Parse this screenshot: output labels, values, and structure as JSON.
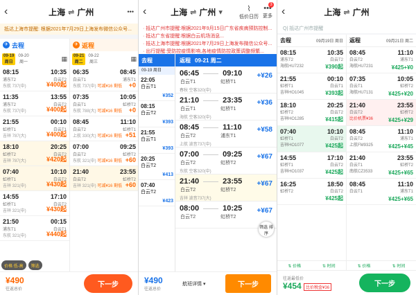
{
  "app1": {
    "back": "‹",
    "from": "上海",
    "to": "广州",
    "swap": "⇌",
    "more": "•••",
    "notice": "抵达上海市提醒: 根据2021年7月29日上海发布微信公众号...",
    "go_title": "去程",
    "ret_title": "返程",
    "go_dates": [
      {
        "d": "09-19",
        "w": "周日",
        "sel": true
      },
      {
        "d": "09-20",
        "w": "周一",
        "sel": false
      }
    ],
    "ret_dates": [
      {
        "d": "09-21",
        "w": "周二",
        "sel": true
      },
      {
        "d": "09-22",
        "w": "周三",
        "sel": false
      }
    ],
    "go_flights": [
      {
        "dep": "08:15",
        "arr": "10:35",
        "from": "浦东T2",
        "to": "白云T2",
        "info": "东航 737(中)",
        "price": "¥400起"
      },
      {
        "dep": "11:35",
        "arr": "13:55",
        "from": "浦东T2",
        "to": "白云T2",
        "info": "东航 737(中)",
        "price": "¥400起"
      },
      {
        "dep": "21:55",
        "arr": "00:10",
        "from": "虹桥T1",
        "to": "白云T1",
        "info": "吉祥 787(大)",
        "price": "¥400起"
      },
      {
        "dep": "18:10",
        "arr": "20:25",
        "from": "虹桥T2",
        "to": "白云T2",
        "info": "吉祥 787(大)",
        "price": "¥420起"
      },
      {
        "dep": "07:40",
        "arr": "10:10",
        "from": "虹桥T1",
        "to": "白云T2",
        "info": "吉祥 321(中)",
        "price": "¥430起"
      },
      {
        "dep": "14:55",
        "arr": "17:10",
        "from": "虹桥T1",
        "to": "白云T2",
        "info": "吉祥 321(中)",
        "price": "¥430起"
      },
      {
        "dep": "21:50",
        "arr": "00:15",
        "from": "浦东T1",
        "to": "白云T1",
        "info": "东航 321(中)",
        "price": "¥440起"
      }
    ],
    "ret_flights": [
      {
        "dep": "06:35",
        "arr": "08:45",
        "from": "白云T1",
        "to": "浦东T1",
        "info": "东航 737(中)",
        "tag": "可减¥16",
        "tag2": "剩低",
        "price": "+0"
      },
      {
        "dep": "07:35",
        "arr": "10:05",
        "from": "白云T1",
        "to": "虹桥T2",
        "info": "东航 788(大)",
        "tag": "可减¥16",
        "tag2": "剩低",
        "price": "+0"
      },
      {
        "dep": "08:45",
        "arr": "11:10",
        "from": "白云T2",
        "to": "虹桥T1",
        "info": "上航 330(大)",
        "tag": "可减¥16",
        "tag2": "剩低",
        "price": "+51"
      },
      {
        "dep": "07:00",
        "arr": "09:25",
        "from": "白云T2",
        "to": "虹桥T2",
        "info": "东航 321(中)",
        "tag": "可减¥16",
        "tag2": "剩低",
        "price": "+60"
      },
      {
        "dep": "21:40",
        "arr": "23:55",
        "from": "白云T2",
        "to": "虹桥T2",
        "info": "吉祥 321(中)",
        "tag": "可减¥16",
        "tag2": "剩低",
        "price": "+60"
      }
    ],
    "filter1": "价格 低-高",
    "filter2": "筛选",
    "total": "¥490",
    "total_label": "往返总价",
    "next": "下一步"
  },
  "app2": {
    "back": "‹",
    "from": "上海",
    "to": "广州",
    "icon1": "低价日历",
    "icon2": "更多",
    "badge": "3",
    "notices": [
      "· 抵达广州市提醒:根据2021年9月15日广东省疾病预防控制...",
      "· 抵达广东省提醒:根据白云机场消息...",
      "· 抵达上海市提醒:根据2021年7月29日上海发布微信公众号...",
      "· 出行提醒:受防控疫情影响,各地疫情防控政策调整频繁..."
    ],
    "left_head": "去程",
    "left_date": "09-19 周日",
    "left_flights": [
      {
        "dep": "22:05",
        "to": "白云T1",
        "price": "¥352"
      },
      {
        "dep": "08:15",
        "to": "白云T2",
        "price": "¥393"
      },
      {
        "dep": "21:55",
        "to": "白云T1",
        "price": "¥393"
      },
      {
        "dep": "20:25",
        "to": "白云T2",
        "price": "¥413"
      },
      {
        "dep": "07:40",
        "to": "白云T2",
        "price": "¥423"
      }
    ],
    "right_head": "返程",
    "right_date": "09-21 周二",
    "right_flights": [
      {
        "dep": "06:45",
        "arr": "09:10",
        "from": "白云T1",
        "to": "虹桥T1",
        "info": "春秋 空客320(中)",
        "price": "+¥26",
        "hl": false
      },
      {
        "dep": "21:10",
        "arr": "23:35",
        "from": "白云T1",
        "to": "虹桥T1",
        "info": "海航 空客320(中)",
        "price": "+¥36",
        "hl": false
      },
      {
        "dep": "08:45",
        "arr": "11:10",
        "from": "白云T2",
        "to": "浦东T1",
        "info": "上航 波音737(中)",
        "price": "+¥58",
        "hl": false
      },
      {
        "dep": "07:00",
        "arr": "09:25",
        "from": "白云T2",
        "to": "虹桥T2",
        "info": "东航 空客320(中)",
        "price": "+¥67",
        "hl": false
      },
      {
        "dep": "21:40",
        "arr": "23:55",
        "from": "白云T2",
        "to": "虹桥T2",
        "info": "吉祥 波音737(大)",
        "price": "+¥67",
        "hl": true
      },
      {
        "dep": "08:00",
        "arr": "10:25",
        "from": "白云T2",
        "to": "虹桥T2",
        "info": "",
        "price": "+¥67",
        "hl": false
      }
    ],
    "sort": "筛选 排序",
    "total": "¥490",
    "total_label": "往返总价",
    "detail": "航班详情 ▾",
    "next": "下一步"
  },
  "app3": {
    "back": "‹",
    "from": "上海",
    "to": "广州",
    "search": "Q| 抵达广州市提醒",
    "go_title": "去程",
    "go_date": "09月19日 周日",
    "ret_title": "返程",
    "ret_date": "09月21日 周二",
    "go_flights": [
      {
        "dep": "08:15",
        "arr": "10:35",
        "from": "浦东T2",
        "to": "白云T2",
        "info": "海航HU7232",
        "price": "¥390起",
        "cls": ""
      },
      {
        "dep": "21:55",
        "arr": "00:10",
        "from": "虹桥T1",
        "to": "白云T1",
        "info": "吉祥HO1045",
        "price": "¥393起",
        "cls": ""
      },
      {
        "dep": "18:10",
        "arr": "20:25",
        "from": "虹桥T2",
        "to": "白云T2",
        "info": "吉祥HO1285",
        "price": "¥415起",
        "cls": ""
      },
      {
        "dep": "07:40",
        "arr": "10:10",
        "from": "虹桥T1",
        "to": "白云T2",
        "info": "吉祥HO1077",
        "price": "¥425起",
        "cls": "sel"
      },
      {
        "dep": "14:55",
        "arr": "17:10",
        "from": "虹桥T1",
        "to": "白云T2",
        "info": "吉祥HO1037",
        "price": "¥425起",
        "cls": ""
      },
      {
        "dep": "16:25",
        "arr": "18:50",
        "from": "虹桥T2",
        "to": "白云T2",
        "info": "",
        "price": "¥425起",
        "cls": ""
      }
    ],
    "ret_flights": [
      {
        "dep": "08:45",
        "arr": "11:10",
        "from": "白云T2",
        "to": "浦东T1",
        "info": "海航HU7231",
        "price": "¥425+¥0",
        "cls": ""
      },
      {
        "dep": "07:35",
        "arr": "10:05",
        "from": "白云T1",
        "to": "虹桥T2",
        "info": "海航HU7131",
        "price": "¥425+¥20",
        "cls": ""
      },
      {
        "dep": "21:40",
        "arr": "23:55",
        "from": "白云T2",
        "to": "虹桥T2",
        "info": "比价机票¥36",
        "price": "¥425+¥29",
        "cls": "red"
      },
      {
        "dep": "08:45",
        "arr": "11:10",
        "from": "白云T2",
        "to": "浦东T1",
        "info": "上航FM9325",
        "price": "¥425+¥45",
        "cls": ""
      },
      {
        "dep": "21:40",
        "arr": "23:55",
        "from": "白云T1",
        "to": "虹桥T2",
        "info": "南航CZ3533",
        "price": "¥425+¥65",
        "cls": ""
      },
      {
        "dep": "08:45",
        "arr": "11:10",
        "from": "白云T1",
        "to": "浦东T1",
        "info": "",
        "price": "¥425+¥65",
        "cls": ""
      }
    ],
    "filter_price": "⇅ 价格",
    "filter_time": "⇅ 时间",
    "total_label": "往返最低价",
    "total": "¥454",
    "tag": "比价税金¥36",
    "next": "下一步"
  }
}
